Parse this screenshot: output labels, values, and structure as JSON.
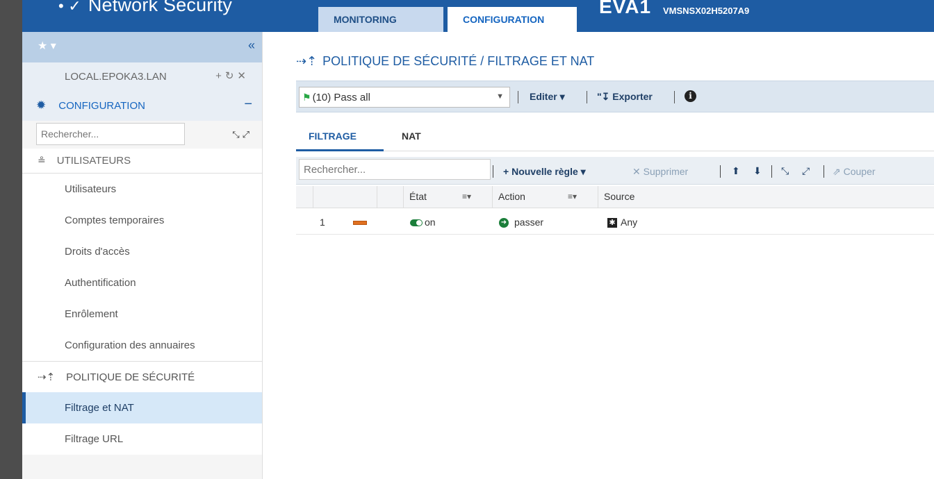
{
  "header": {
    "brand": "Network Security",
    "tabs": [
      {
        "label": "MONITORING"
      },
      {
        "label": "CONFIGURATION"
      }
    ],
    "model": "EVA1",
    "serial": "VMSNSX02H5207A9"
  },
  "sidebar": {
    "host": "LOCAL.EPOKA3.LAN",
    "config_label": "CONFIGURATION",
    "search_placeholder": "Rechercher...",
    "users_section": "UTILISATEURS",
    "users_items": [
      {
        "label": "Utilisateurs"
      },
      {
        "label": "Comptes temporaires"
      },
      {
        "label": "Droits d'accès"
      },
      {
        "label": "Authentification"
      },
      {
        "label": "Enrôlement"
      },
      {
        "label": "Configuration des annuaires"
      }
    ],
    "security_section": "POLITIQUE DE SÉCURITÉ",
    "security_items": [
      {
        "label": "Filtrage et NAT",
        "active": true
      },
      {
        "label": "Filtrage URL"
      }
    ]
  },
  "main": {
    "title": "POLITIQUE DE SÉCURITÉ / FILTRAGE ET NAT",
    "policy_selected": "(10) Pass all",
    "edit_label": "Editer",
    "export_label": "Exporter",
    "tabs": [
      {
        "label": "FILTRAGE"
      },
      {
        "label": "NAT"
      }
    ],
    "grid_search_placeholder": "Rechercher...",
    "new_rule_label": "Nouvelle règle",
    "delete_label": "Supprimer",
    "cut_label": "Couper",
    "columns": [
      {
        "label": "État"
      },
      {
        "label": "Action"
      },
      {
        "label": "Source"
      }
    ],
    "rows": [
      {
        "num": "1",
        "state": "on",
        "action": "passer",
        "source": "Any"
      }
    ]
  }
}
